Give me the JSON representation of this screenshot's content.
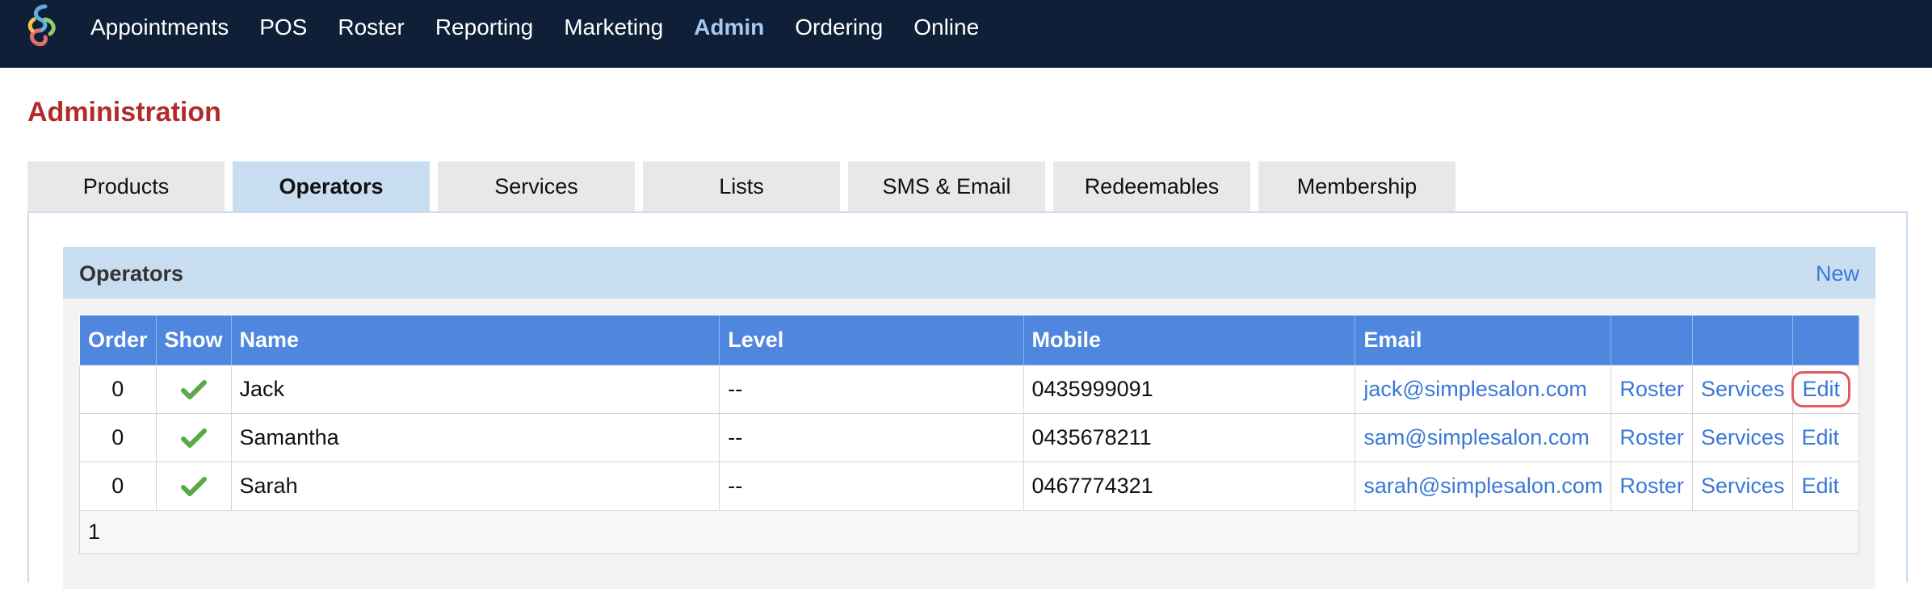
{
  "nav": {
    "items": [
      {
        "label": "Appointments",
        "active": false
      },
      {
        "label": "POS",
        "active": false
      },
      {
        "label": "Roster",
        "active": false
      },
      {
        "label": "Reporting",
        "active": false
      },
      {
        "label": "Marketing",
        "active": false
      },
      {
        "label": "Admin",
        "active": true
      },
      {
        "label": "Ordering",
        "active": false
      },
      {
        "label": "Online",
        "active": false
      }
    ]
  },
  "page": {
    "title": "Administration"
  },
  "tabs": [
    {
      "label": "Products",
      "active": false
    },
    {
      "label": "Operators",
      "active": true
    },
    {
      "label": "Services",
      "active": false
    },
    {
      "label": "Lists",
      "active": false
    },
    {
      "label": "SMS & Email",
      "active": false
    },
    {
      "label": "Redeemables",
      "active": false
    },
    {
      "label": "Membership",
      "active": false
    }
  ],
  "section": {
    "title": "Operators",
    "new_label": "New"
  },
  "table": {
    "columns": [
      "Order",
      "Show",
      "Name",
      "Level",
      "Mobile",
      "Email",
      "",
      "",
      ""
    ],
    "rows": [
      {
        "order": "0",
        "show": true,
        "name": "Jack",
        "level": "--",
        "mobile": "0435999091",
        "email": "jack@simplesalon.com",
        "roster": "Roster",
        "services": "Services",
        "edit": "Edit"
      },
      {
        "order": "0",
        "show": true,
        "name": "Samantha",
        "level": "--",
        "mobile": "0435678211",
        "email": "sam@simplesalon.com",
        "roster": "Roster",
        "services": "Services",
        "edit": "Edit"
      },
      {
        "order": "0",
        "show": true,
        "name": "Sarah",
        "level": "--",
        "mobile": "0467774321",
        "email": "sarah@simplesalon.com",
        "roster": "Roster",
        "services": "Services",
        "edit": "Edit"
      }
    ],
    "pagination": "1"
  },
  "colors": {
    "nav_bg": "#0f1f38",
    "accent": "#3a78d6",
    "header_blue": "#4f86de",
    "title_red": "#b22a2a",
    "check_green": "#5aa84a",
    "highlight": "#e05c5c"
  }
}
